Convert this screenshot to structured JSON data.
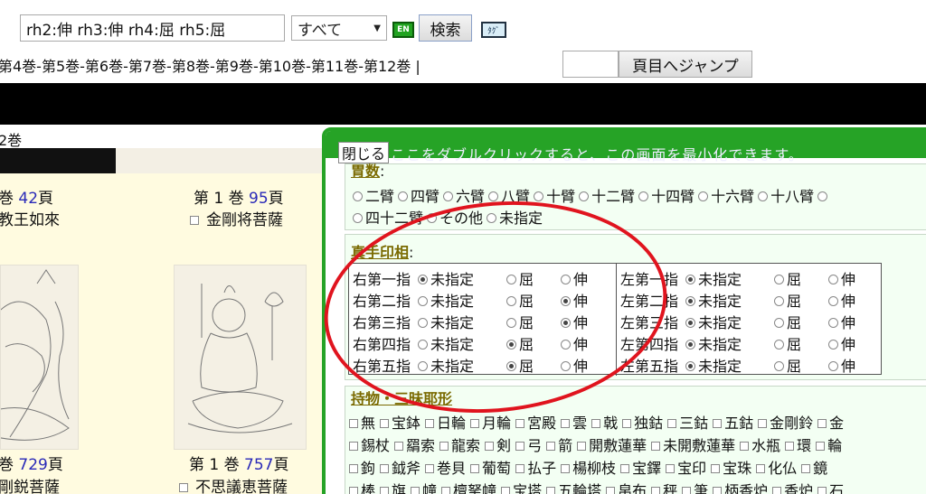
{
  "search": {
    "value": "rh2:伸 rh3:伸 rh4:屈 rh5:屈",
    "select_value": "すべて",
    "en_label": "EN",
    "search_label": "検索",
    "tag_label": "ﾀｸﾞ"
  },
  "volume_nav": {
    "text": "第4巻-第5巻-第6巻-第7巻-第8巻-第9巻-第10巻-第11巻-第12巻 |",
    "jump_label": "頁目へジャンプ"
  },
  "results": {
    "volume_label": "2巻",
    "items": [
      {
        "vol": "巻",
        "num": "42",
        "page": "頁",
        "name": "教王如來",
        "checkbox": false
      },
      {
        "vol": "第 1 巻",
        "num": "95",
        "page": "頁",
        "name": "金剛将菩薩",
        "checkbox": true
      },
      {
        "vol": "巻",
        "num": "729",
        "page": "頁",
        "name": "剛鋭菩薩",
        "checkbox": false
      },
      {
        "vol": "第 1 巻",
        "num": "757",
        "page": "頁",
        "name": "不思議恵菩薩",
        "checkbox": true
      }
    ]
  },
  "panel": {
    "close_label": "閉じる",
    "hint": "ここをダブルクリックすると、この画面を最小化できます。",
    "arms": {
      "title": "胃数",
      "row1": [
        "二臂",
        "四臂",
        "六臂",
        "八臂",
        "十臂",
        "十二臂",
        "十四臂",
        "十六臂",
        "十八臂"
      ],
      "row2": [
        "四十二臂",
        "その他",
        "未指定"
      ]
    },
    "mudra": {
      "title": "真手印相",
      "opt_unspecified": "未指定",
      "opt_bent": "屈",
      "opt_straight": "伸",
      "right": [
        {
          "label": "右第一指",
          "selected": 0
        },
        {
          "label": "右第二指",
          "selected": 2
        },
        {
          "label": "右第三指",
          "selected": 2
        },
        {
          "label": "右第四指",
          "selected": 1
        },
        {
          "label": "右第五指",
          "selected": 1
        }
      ],
      "left": [
        {
          "label": "左第一指",
          "selected": 0
        },
        {
          "label": "左第二指",
          "selected": 0
        },
        {
          "label": "左第三指",
          "selected": 0
        },
        {
          "label": "左第四指",
          "selected": 0
        },
        {
          "label": "左第五指",
          "selected": 0
        }
      ]
    },
    "attributes": {
      "title": "持物・三昧耶形",
      "rows": [
        [
          "無",
          "宝鉢",
          "日輪",
          "月輪",
          "宮殿",
          "雲",
          "戟",
          "独鈷",
          "三鈷",
          "五鈷",
          "金剛鈴",
          "金"
        ],
        [
          "錫杖",
          "羂索",
          "龍索",
          "剣",
          "弓",
          "箭",
          "開敷蓮華",
          "未開敷蓮華",
          "水瓶",
          "環",
          "輪"
        ],
        [
          "鉤",
          "鉞斧",
          "巻貝",
          "葡萄",
          "払子",
          "楊柳枝",
          "宝鐸",
          "宝印",
          "宝珠",
          "化仏",
          "鏡"
        ],
        [
          "棒",
          "旗",
          "幢",
          "檀拏幢",
          "宝塔",
          "五輪塔",
          "帛布",
          "秤",
          "筆",
          "柄香炉",
          "香炉",
          "石"
        ]
      ]
    }
  }
}
